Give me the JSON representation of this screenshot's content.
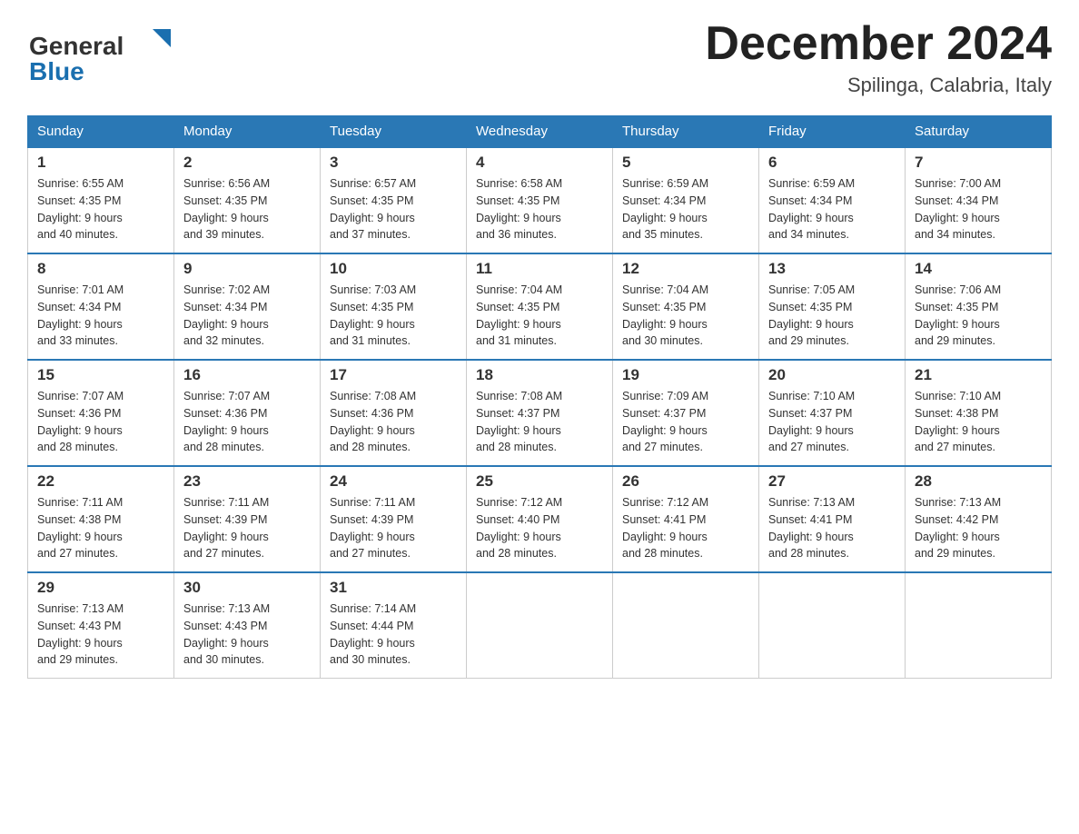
{
  "header": {
    "logo_general": "General",
    "logo_blue": "Blue",
    "month_title": "December 2024",
    "subtitle": "Spilinga, Calabria, Italy"
  },
  "days_of_week": [
    "Sunday",
    "Monday",
    "Tuesday",
    "Wednesday",
    "Thursday",
    "Friday",
    "Saturday"
  ],
  "weeks": [
    [
      {
        "day": "1",
        "sunrise": "6:55 AM",
        "sunset": "4:35 PM",
        "daylight": "9 hours and 40 minutes."
      },
      {
        "day": "2",
        "sunrise": "6:56 AM",
        "sunset": "4:35 PM",
        "daylight": "9 hours and 39 minutes."
      },
      {
        "day": "3",
        "sunrise": "6:57 AM",
        "sunset": "4:35 PM",
        "daylight": "9 hours and 37 minutes."
      },
      {
        "day": "4",
        "sunrise": "6:58 AM",
        "sunset": "4:35 PM",
        "daylight": "9 hours and 36 minutes."
      },
      {
        "day": "5",
        "sunrise": "6:59 AM",
        "sunset": "4:34 PM",
        "daylight": "9 hours and 35 minutes."
      },
      {
        "day": "6",
        "sunrise": "6:59 AM",
        "sunset": "4:34 PM",
        "daylight": "9 hours and 34 minutes."
      },
      {
        "day": "7",
        "sunrise": "7:00 AM",
        "sunset": "4:34 PM",
        "daylight": "9 hours and 34 minutes."
      }
    ],
    [
      {
        "day": "8",
        "sunrise": "7:01 AM",
        "sunset": "4:34 PM",
        "daylight": "9 hours and 33 minutes."
      },
      {
        "day": "9",
        "sunrise": "7:02 AM",
        "sunset": "4:34 PM",
        "daylight": "9 hours and 32 minutes."
      },
      {
        "day": "10",
        "sunrise": "7:03 AM",
        "sunset": "4:35 PM",
        "daylight": "9 hours and 31 minutes."
      },
      {
        "day": "11",
        "sunrise": "7:04 AM",
        "sunset": "4:35 PM",
        "daylight": "9 hours and 31 minutes."
      },
      {
        "day": "12",
        "sunrise": "7:04 AM",
        "sunset": "4:35 PM",
        "daylight": "9 hours and 30 minutes."
      },
      {
        "day": "13",
        "sunrise": "7:05 AM",
        "sunset": "4:35 PM",
        "daylight": "9 hours and 29 minutes."
      },
      {
        "day": "14",
        "sunrise": "7:06 AM",
        "sunset": "4:35 PM",
        "daylight": "9 hours and 29 minutes."
      }
    ],
    [
      {
        "day": "15",
        "sunrise": "7:07 AM",
        "sunset": "4:36 PM",
        "daylight": "9 hours and 28 minutes."
      },
      {
        "day": "16",
        "sunrise": "7:07 AM",
        "sunset": "4:36 PM",
        "daylight": "9 hours and 28 minutes."
      },
      {
        "day": "17",
        "sunrise": "7:08 AM",
        "sunset": "4:36 PM",
        "daylight": "9 hours and 28 minutes."
      },
      {
        "day": "18",
        "sunrise": "7:08 AM",
        "sunset": "4:37 PM",
        "daylight": "9 hours and 28 minutes."
      },
      {
        "day": "19",
        "sunrise": "7:09 AM",
        "sunset": "4:37 PM",
        "daylight": "9 hours and 27 minutes."
      },
      {
        "day": "20",
        "sunrise": "7:10 AM",
        "sunset": "4:37 PM",
        "daylight": "9 hours and 27 minutes."
      },
      {
        "day": "21",
        "sunrise": "7:10 AM",
        "sunset": "4:38 PM",
        "daylight": "9 hours and 27 minutes."
      }
    ],
    [
      {
        "day": "22",
        "sunrise": "7:11 AM",
        "sunset": "4:38 PM",
        "daylight": "9 hours and 27 minutes."
      },
      {
        "day": "23",
        "sunrise": "7:11 AM",
        "sunset": "4:39 PM",
        "daylight": "9 hours and 27 minutes."
      },
      {
        "day": "24",
        "sunrise": "7:11 AM",
        "sunset": "4:39 PM",
        "daylight": "9 hours and 27 minutes."
      },
      {
        "day": "25",
        "sunrise": "7:12 AM",
        "sunset": "4:40 PM",
        "daylight": "9 hours and 28 minutes."
      },
      {
        "day": "26",
        "sunrise": "7:12 AM",
        "sunset": "4:41 PM",
        "daylight": "9 hours and 28 minutes."
      },
      {
        "day": "27",
        "sunrise": "7:13 AM",
        "sunset": "4:41 PM",
        "daylight": "9 hours and 28 minutes."
      },
      {
        "day": "28",
        "sunrise": "7:13 AM",
        "sunset": "4:42 PM",
        "daylight": "9 hours and 29 minutes."
      }
    ],
    [
      {
        "day": "29",
        "sunrise": "7:13 AM",
        "sunset": "4:43 PM",
        "daylight": "9 hours and 29 minutes."
      },
      {
        "day": "30",
        "sunrise": "7:13 AM",
        "sunset": "4:43 PM",
        "daylight": "9 hours and 30 minutes."
      },
      {
        "day": "31",
        "sunrise": "7:14 AM",
        "sunset": "4:44 PM",
        "daylight": "9 hours and 30 minutes."
      },
      null,
      null,
      null,
      null
    ]
  ],
  "labels": {
    "sunrise": "Sunrise:",
    "sunset": "Sunset:",
    "daylight": "Daylight:"
  }
}
